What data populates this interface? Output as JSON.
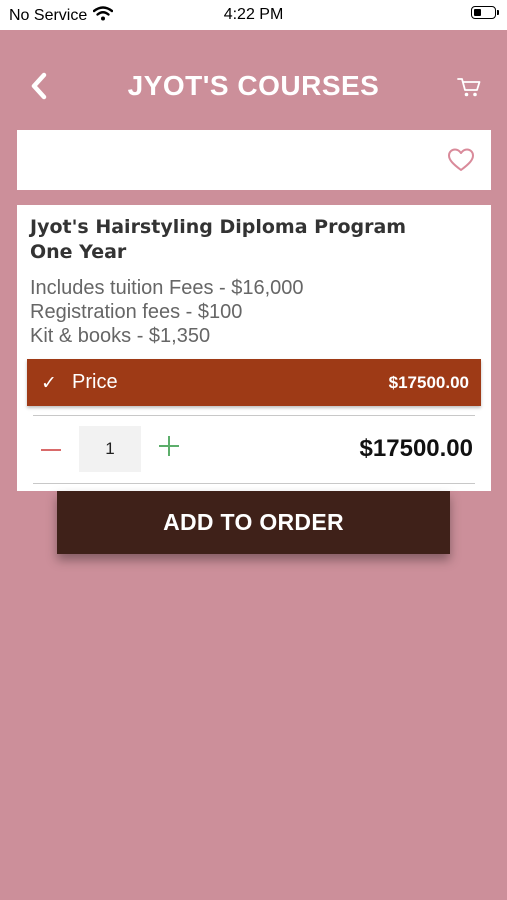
{
  "status_bar": {
    "carrier": "No Service",
    "time": "4:22 PM"
  },
  "header": {
    "title": "JYOT'S COURSES",
    "back_icon": "chevron-left-icon",
    "cart_icon": "cart-icon"
  },
  "favorite": {
    "icon": "heart-outline-icon"
  },
  "product": {
    "title_line1": "Jyot's Hairstyling Diploma Program",
    "title_line2": "One Year",
    "description": [
      "Includes tuition Fees - $16,000",
      "Registration fees - $100",
      "Kit & books - $1,350"
    ],
    "price_option": {
      "check": "✓",
      "label": "Price",
      "value": "$17500.00"
    },
    "quantity": "1",
    "total": "$17500.00"
  },
  "actions": {
    "add_to_order_label": "ADD TO ORDER"
  },
  "colors": {
    "background": "#cc8f9a",
    "price_bar": "#9e3a16",
    "add_button": "#3f2119",
    "minus": "#d96a6a",
    "plus": "#5cae6b",
    "heart": "#d98a9a"
  }
}
